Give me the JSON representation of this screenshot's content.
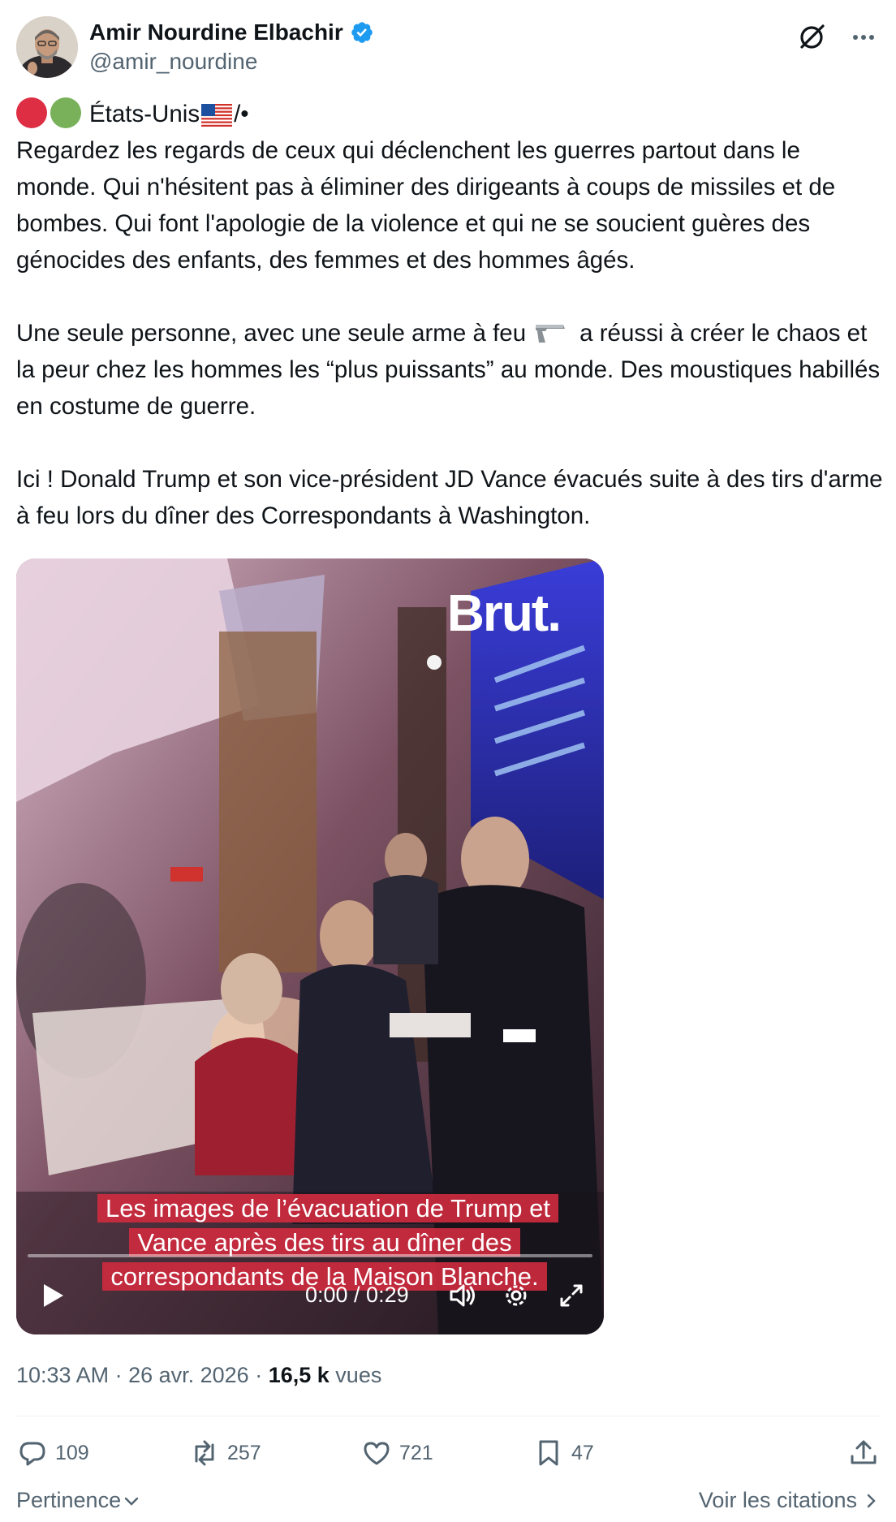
{
  "author": {
    "display_name": "Amir Nourdine Elbachir",
    "handle": "@amir_nourdine",
    "verified": true
  },
  "tweet": {
    "first_line_text": "États-Unis",
    "first_line_suffix": "/•",
    "paragraph1": "Regardez les regards de ceux qui déclenchent les guerres partout dans le monde. Qui n'hésitent pas à éliminer des dirigeants à coups de missiles et de bombes. Qui font l'apologie de la violence et qui ne se soucient guères des génocides des enfants, des femmes et des hommes âgés.",
    "paragraph2_before": "Une seule personne, avec une seule arme à feu",
    "paragraph2_after": "a réussi à créer le chaos et la peur chez les hommes les “plus puissants” au monde. Des moustiques habillés en costume de guerre.",
    "paragraph3": "Ici ! Donald Trump et son vice-président JD Vance évacués suite à des tirs d'arme à feu lors du dîner des Correspondants à Washington.",
    "emojis": [
      "red-circle",
      "green-circle",
      "us-flag",
      "pistol"
    ]
  },
  "video": {
    "watermark": "Brut.",
    "caption": "Les images de l’évacuation de Trump et Vance après des tirs au dîner des correspondants de la Maison Blanche.",
    "time_display": "0:00 / 0:29",
    "progress_fraction": 0.0
  },
  "meta": {
    "time": "10:33 AM",
    "separator": " · ",
    "date": "26 avr. 2026",
    "views_count": "16,5 k",
    "views_label": "vues"
  },
  "actions": {
    "replies": "109",
    "reposts": "257",
    "likes": "721",
    "bookmarks": "47"
  },
  "footer": {
    "sort_label": "Pertinence",
    "quotes_label": "Voir les citations"
  },
  "colors": {
    "text": "#0f1419",
    "secondary": "#536471",
    "verified": "#1d9bf0",
    "caption_bg": "#cd2a3e"
  }
}
